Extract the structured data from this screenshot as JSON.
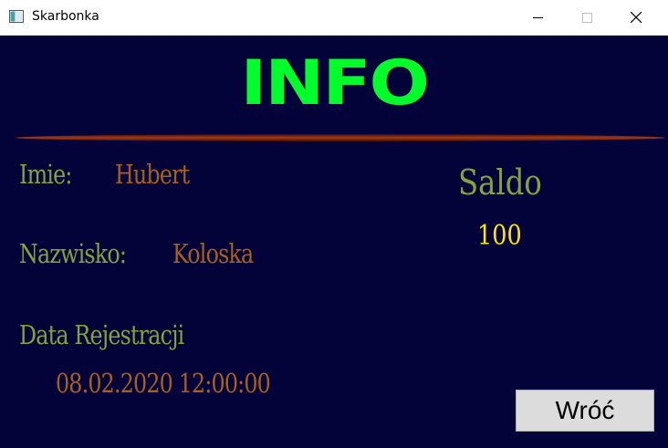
{
  "window": {
    "title": "Skarbonka",
    "controls": {
      "minimize_icon": "minimize-icon",
      "maximize_icon": "maximize-icon",
      "close_icon": "close-icon"
    }
  },
  "main": {
    "heading": "INFO",
    "first_name": {
      "label": "Imie:",
      "value": "Hubert"
    },
    "last_name": {
      "label": "Nazwisko:",
      "value": "Koloska"
    },
    "registration": {
      "label": "Data  Rejestracji",
      "value": "08.02.2020  12:00:00"
    },
    "balance": {
      "label": "Saldo",
      "value": "100"
    },
    "back_button_label": "Wróć"
  },
  "colors": {
    "background": "#03033a",
    "heading": "#00ff2a",
    "label": "#86a33a",
    "value": "#a8601f",
    "balance_value": "#ffe800",
    "divider": "#8b2a10"
  }
}
